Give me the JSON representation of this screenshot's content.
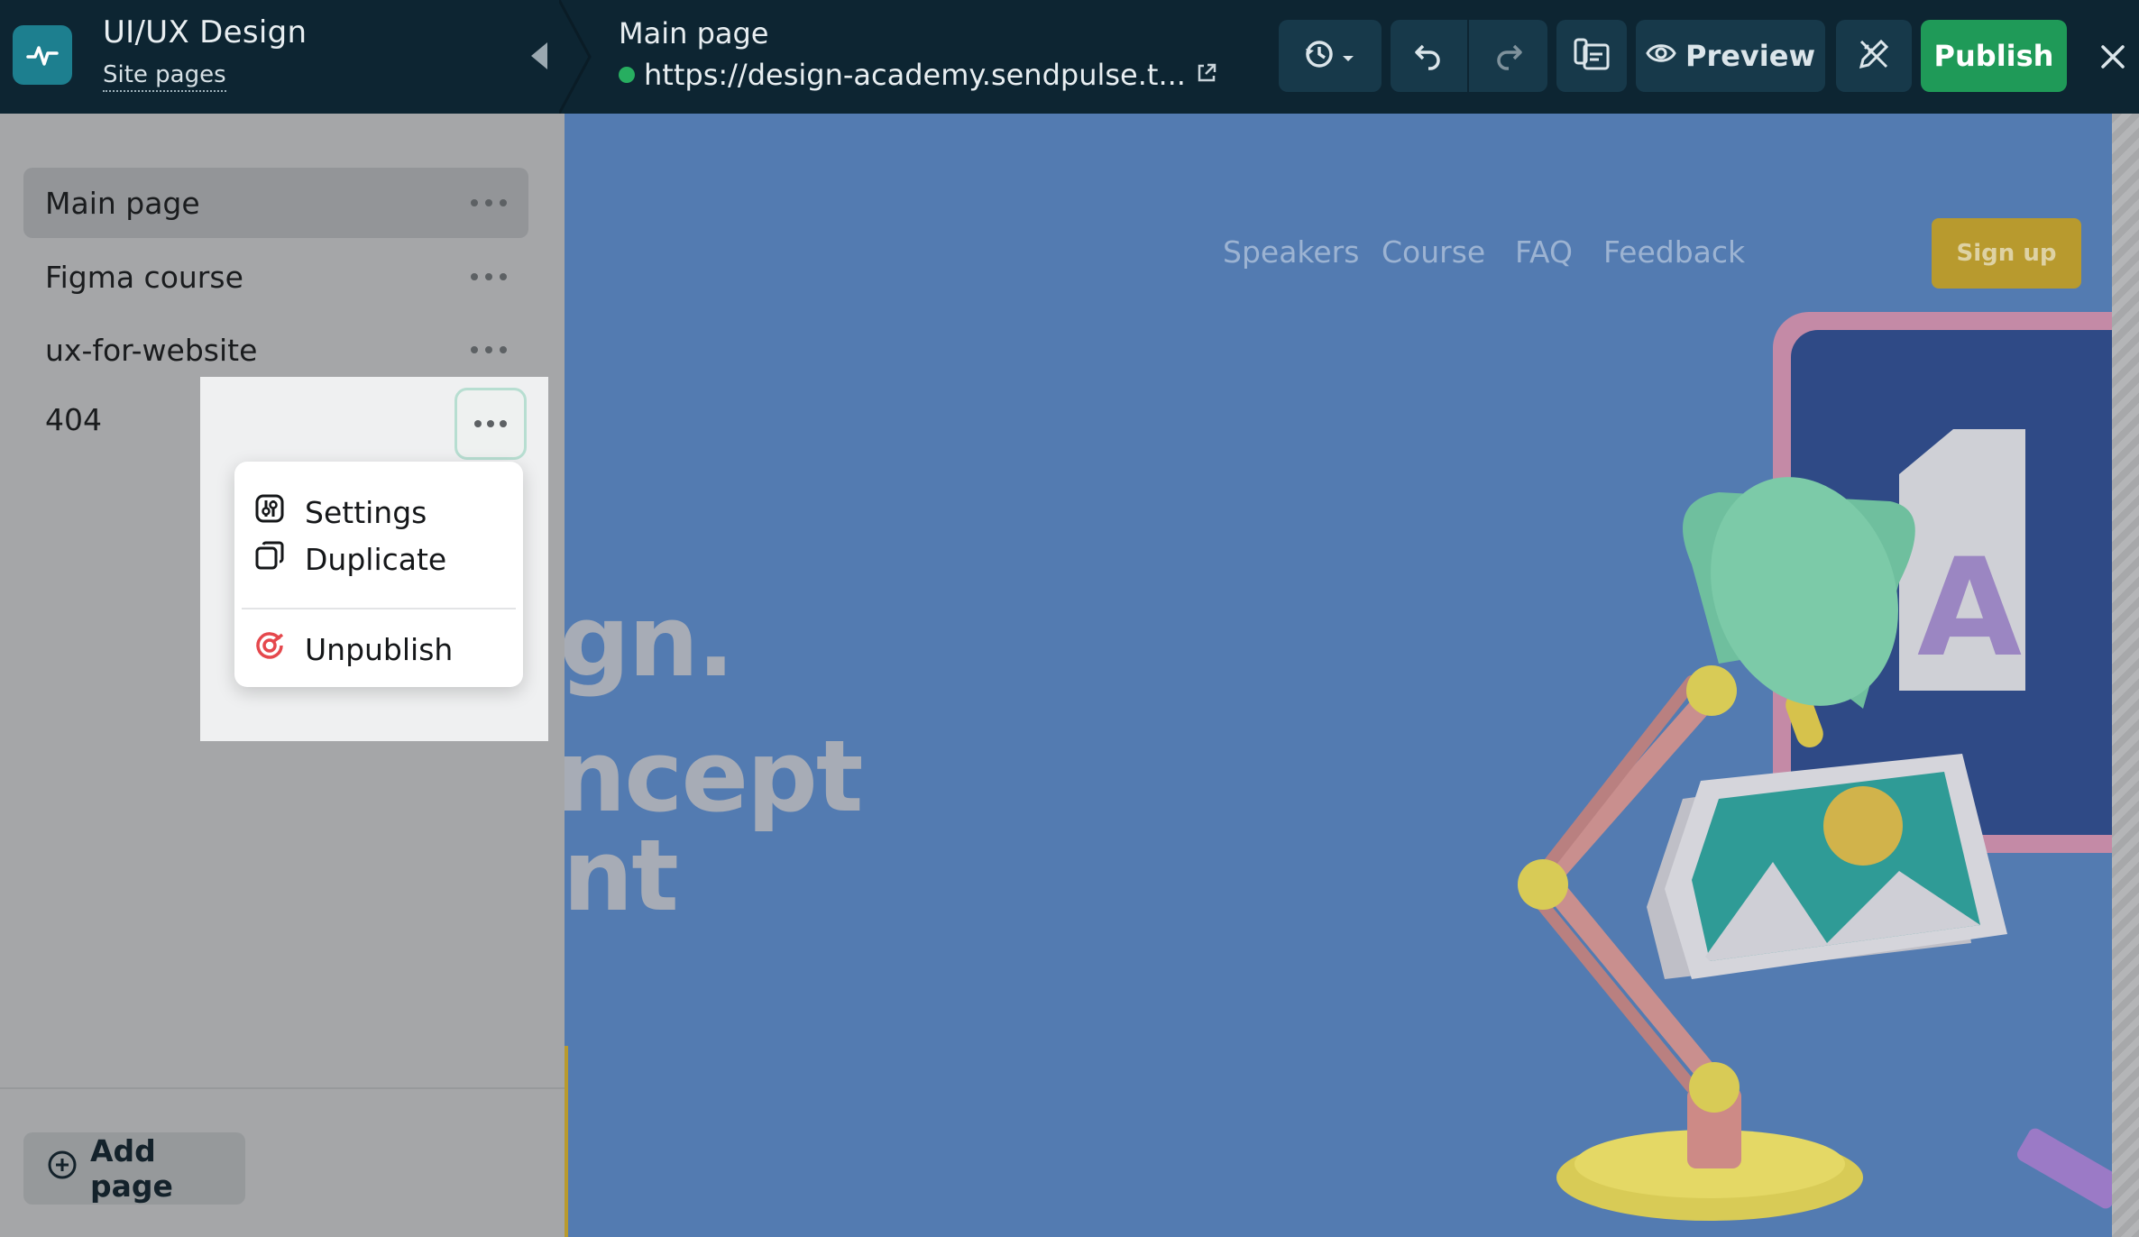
{
  "topbar": {
    "site_title": "UI/UX Design",
    "site_subtitle": "Site pages",
    "page_title": "Main page",
    "page_url": "https://design-academy.sendpulse.t...",
    "status_color": "#27ae60",
    "preview_label": "Preview",
    "publish_label": "Publish",
    "publish_color": "#1f9a58"
  },
  "sidebar": {
    "items": [
      {
        "label": "Main page",
        "active": true
      },
      {
        "label": "Figma course",
        "active": false
      },
      {
        "label": "ux-for-website",
        "active": false
      },
      {
        "label": "404",
        "active": false
      }
    ],
    "add_page_label": "Add page"
  },
  "context_menu": {
    "items": [
      {
        "label": "Settings",
        "icon": "settings-icon"
      },
      {
        "label": "Duplicate",
        "icon": "duplicate-icon"
      },
      {
        "label": "Unpublish",
        "icon": "unpublish-icon",
        "color": "#e5484d"
      }
    ]
  },
  "preview": {
    "nav": [
      "Speakers",
      "Course",
      "FAQ",
      "Feedback"
    ],
    "signup_label": "Sign up",
    "hero_lines": [
      "gn.",
      "ncept",
      "nt"
    ],
    "background_color": "#537bb1"
  }
}
